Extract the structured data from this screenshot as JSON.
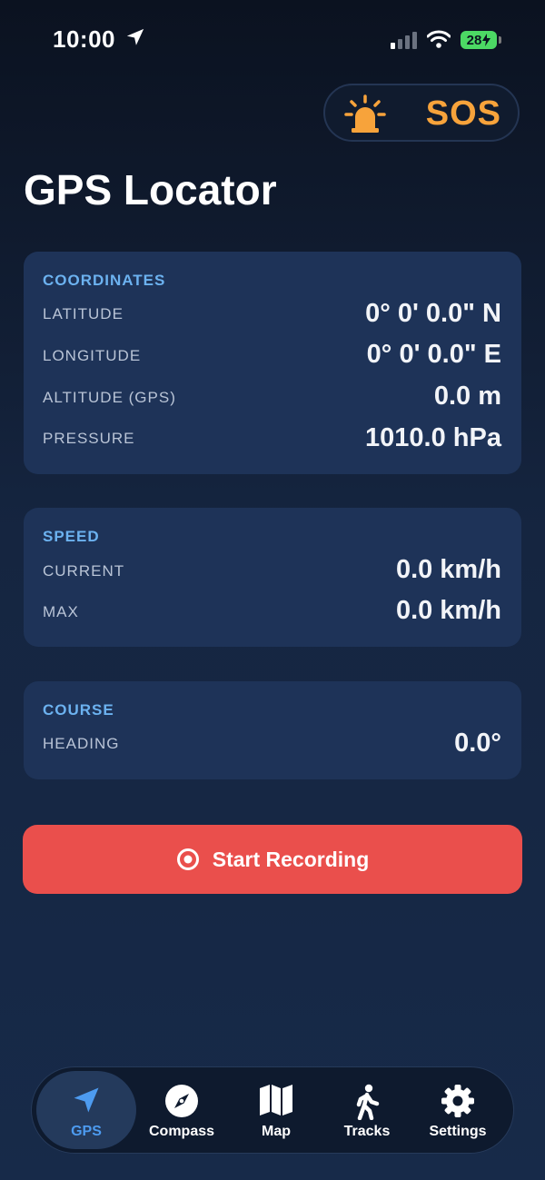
{
  "status_bar": {
    "time": "10:00",
    "battery": "28"
  },
  "sos": {
    "label": "SOS",
    "icon": "siren-icon"
  },
  "page_title": "GPS Locator",
  "coordinates": {
    "title": "COORDINATES",
    "rows": [
      {
        "label": "LATITUDE",
        "value": "0° 0' 0.0\" N"
      },
      {
        "label": "LONGITUDE",
        "value": "0° 0' 0.0\" E"
      },
      {
        "label": "ALTITUDE (GPS)",
        "value": "0.0 m"
      },
      {
        "label": "PRESSURE",
        "value": "1010.0 hPa"
      }
    ]
  },
  "speed": {
    "title": "SPEED",
    "rows": [
      {
        "label": "CURRENT",
        "value": "0.0 km/h"
      },
      {
        "label": "MAX",
        "value": "0.0 km/h"
      }
    ]
  },
  "course": {
    "title": "COURSE",
    "rows": [
      {
        "label": "HEADING",
        "value": "0.0°"
      }
    ]
  },
  "record_button": {
    "label": "Start Recording"
  },
  "tabs": [
    {
      "label": "GPS",
      "icon": "navigation-arrow-icon",
      "active": true
    },
    {
      "label": "Compass",
      "icon": "compass-icon",
      "active": false
    },
    {
      "label": "Map",
      "icon": "map-icon",
      "active": false
    },
    {
      "label": "Tracks",
      "icon": "walking-person-icon",
      "active": false
    },
    {
      "label": "Settings",
      "icon": "gear-icon",
      "active": false
    }
  ],
  "colors": {
    "accent_blue": "#4d9bf0",
    "section_title": "#6cb2f0",
    "sos_orange": "#f7a33b",
    "record_red": "#ea4f4c",
    "card_bg": "#1e3358"
  }
}
